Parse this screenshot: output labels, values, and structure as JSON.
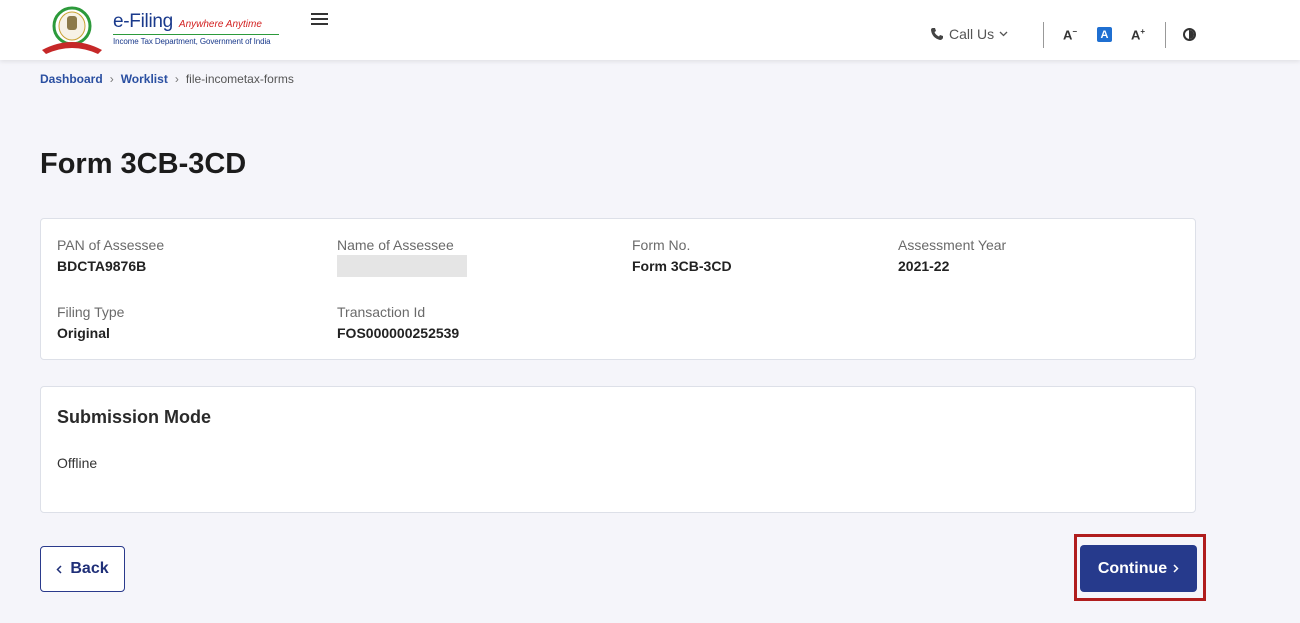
{
  "header": {
    "logo_title": "e-Filing",
    "logo_tagline": "Anywhere Anytime",
    "logo_subtitle": "Income Tax Department, Government of India",
    "call_us": "Call Us",
    "font_decrease": "A",
    "font_default": "A",
    "font_increase": "A"
  },
  "breadcrumb": {
    "items": [
      "Dashboard",
      "Worklist"
    ],
    "current": "file-incometax-forms",
    "separator": "›"
  },
  "page_title": "Form 3CB-3CD",
  "info": {
    "pan_label": "PAN of Assessee",
    "pan_value": "BDCTA9876B",
    "name_label": "Name of Assessee",
    "form_label": "Form No.",
    "form_value": "Form 3CB-3CD",
    "ay_label": "Assessment Year",
    "ay_value": "2021-22",
    "filing_label": "Filing Type",
    "filing_value": "Original",
    "txn_label": "Transaction Id",
    "txn_value": "FOS000000252539"
  },
  "submission": {
    "title": "Submission Mode",
    "value": "Offline"
  },
  "buttons": {
    "back": "Back",
    "continue": "Continue"
  },
  "colors": {
    "primary": "#263a8c",
    "highlight": "#b01d1d",
    "link": "#2a4fa1"
  }
}
